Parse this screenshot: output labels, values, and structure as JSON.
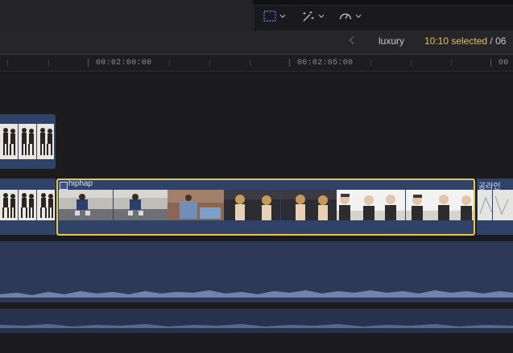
{
  "toolbar": {
    "tools": [
      {
        "icon": "selection-tool-icon"
      },
      {
        "icon": "magic-wand-icon"
      },
      {
        "icon": "speed-gauge-icon"
      }
    ]
  },
  "header": {
    "back_icon": "chevron-left-icon",
    "project_name": "luxury",
    "selection": "10:10 selected",
    "total": "/ 06"
  },
  "ruler": {
    "timecodes": [
      "00:02:00:00",
      "00:02:05:00"
    ]
  },
  "clips": {
    "main_clip": {
      "name": "hiphap",
      "icon": "clip-icon"
    },
    "right_clip": {
      "name": "공라인"
    }
  },
  "colors": {
    "selection": "#e8c84a",
    "clip_blue": "#2f4268",
    "audio_blue": "#2d3a57",
    "selected_text": "#e7c242"
  }
}
